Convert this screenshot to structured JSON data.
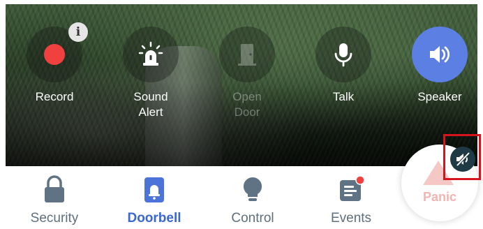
{
  "actions": [
    {
      "id": "record",
      "label": "Record",
      "enabled": true,
      "icon": "record-dot-icon"
    },
    {
      "id": "sound-alert",
      "label": "Sound\nAlert",
      "enabled": true,
      "icon": "siren-icon"
    },
    {
      "id": "open-door",
      "label": "Open\nDoor",
      "enabled": false,
      "icon": "door-icon"
    },
    {
      "id": "talk",
      "label": "Talk",
      "enabled": true,
      "icon": "microphone-icon"
    },
    {
      "id": "speaker",
      "label": "Speaker",
      "enabled": true,
      "active": true,
      "icon": "speaker-icon"
    }
  ],
  "record_info_badge": "i",
  "tabs": [
    {
      "id": "security",
      "label": "Security",
      "active": false,
      "icon": "lock-icon"
    },
    {
      "id": "doorbell",
      "label": "Doorbell",
      "active": true,
      "icon": "doorbell-icon"
    },
    {
      "id": "control",
      "label": "Control",
      "active": false,
      "icon": "bulb-icon"
    },
    {
      "id": "events",
      "label": "Events",
      "active": false,
      "icon": "events-icon",
      "notification_dot": true
    }
  ],
  "panic": {
    "label": "Panic",
    "icon": "warning-icon"
  },
  "mute_button": {
    "icon": "mute-speaker-icon"
  },
  "colors": {
    "accent": "#5b7fe2",
    "active_tab": "#3a67d0",
    "inactive_tab": "#5f6f7c",
    "record": "#f0413e",
    "panic_text": "#f3b3b0",
    "highlight_box": "#d7141d"
  }
}
